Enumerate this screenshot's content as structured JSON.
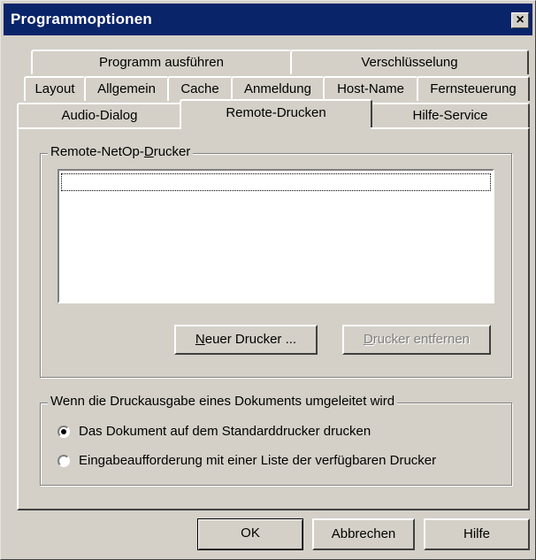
{
  "window": {
    "title": "Programmoptionen",
    "close_glyph": "×"
  },
  "tabs": {
    "row1": [
      "Programm ausführen",
      "Verschlüsselung"
    ],
    "row2": [
      "Layout",
      "Allgemein",
      "Cache",
      "Anmeldung",
      "Host-Name",
      "Fernsteuerung"
    ],
    "row3": [
      "Audio-Dialog",
      "Remote-Drucken",
      "Hilfe-Service"
    ],
    "active": "Remote-Drucken"
  },
  "printers_group": {
    "label_pre": "Remote-NetOp-",
    "label_access": "D",
    "label_post": "rucker",
    "items": [],
    "new_button": {
      "access": "N",
      "rest": "euer Drucker ..."
    },
    "remove_button": {
      "access": "D",
      "rest": "rucker entfernen",
      "enabled": false
    }
  },
  "redirect_group": {
    "label": "Wenn die Druckausgabe eines Dokuments umgeleitet wird",
    "options": [
      {
        "label": "Das Dokument auf dem Standarddrucker drucken",
        "selected": true
      },
      {
        "label": "Eingabeaufforderung mit einer Liste der verfügbaren Drucker",
        "selected": false
      }
    ]
  },
  "footer": {
    "ok": "OK",
    "cancel": "Abbrechen",
    "help": "Hilfe"
  },
  "colors": {
    "face": "#d4d0c8",
    "titlebar": "#0a246a",
    "shadow": "#404040",
    "disabled_text": "#808080"
  }
}
